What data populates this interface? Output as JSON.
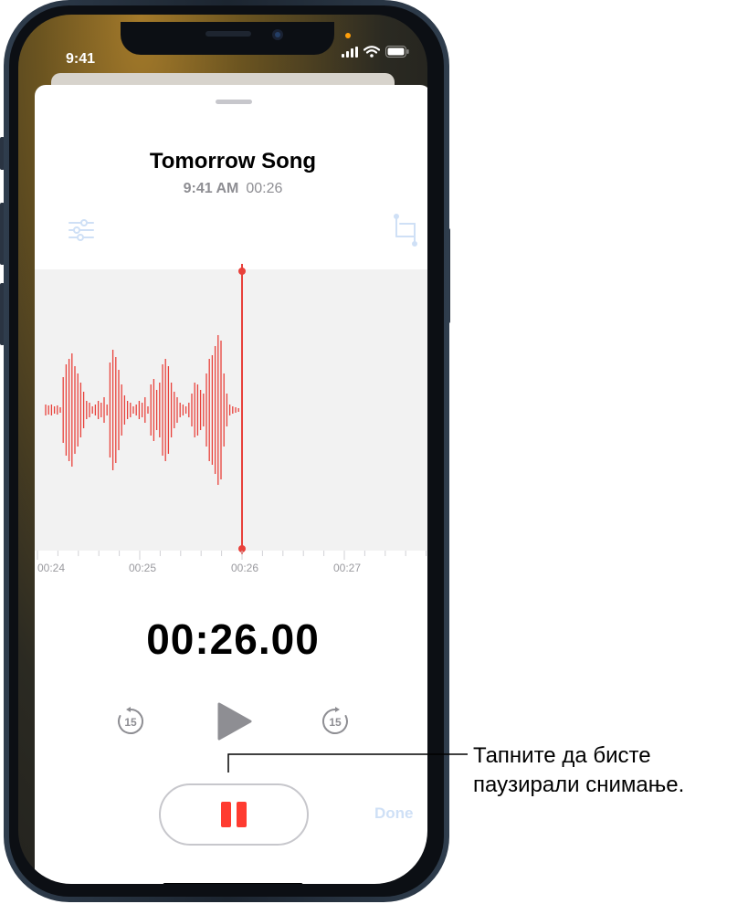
{
  "status_bar": {
    "time": "9:41"
  },
  "recording": {
    "title": "Tomorrow Song",
    "time_of_day": "9:41 AM",
    "duration": "00:26",
    "timer": "00:26.00"
  },
  "timeline": {
    "tick_labels": [
      "00:24",
      "00:25",
      "00:26",
      "00:27"
    ]
  },
  "buttons": {
    "skip_back_label": "15",
    "skip_forward_label": "15",
    "done_label": "Done"
  },
  "callout": {
    "line1": "Тапните да бисте",
    "line2": "паузирали снимање."
  },
  "colors": {
    "waveform": "#e8413b",
    "playhead": "#e8413b",
    "pause": "#ff3b30",
    "done_disabled": "#cfe0f6"
  },
  "icons": {
    "filter": "sliders-icon",
    "trim": "crop-icon",
    "back": "skip-back-15-icon",
    "play": "play-icon",
    "forward": "skip-forward-15-icon",
    "pause": "pause-icon"
  }
}
